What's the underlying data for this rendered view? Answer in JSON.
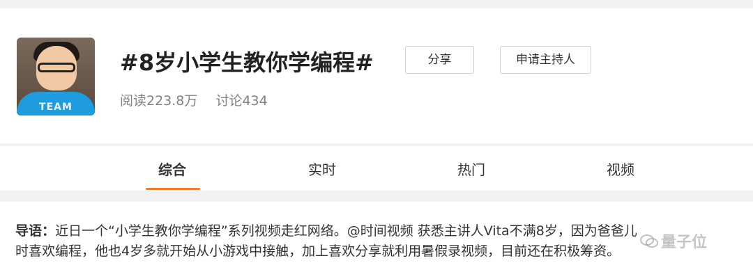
{
  "topic": {
    "title": "#8岁小学生教你学编程#",
    "share_label": "分享",
    "host_label": "申请主持人",
    "reads": "阅读223.8万",
    "discussions": "讨论434"
  },
  "avatar": {
    "shirt_text": "TEAM"
  },
  "tabs": [
    {
      "label": "综合",
      "active": true
    },
    {
      "label": "实时",
      "active": false
    },
    {
      "label": "热门",
      "active": false
    },
    {
      "label": "视频",
      "active": false
    }
  ],
  "intro": {
    "label": "导语：",
    "line1": "近日一个“小学生教你学编程”系列视频走红网络。@时间视频 获悉主讲人Vita不满8岁，因为爸爸儿",
    "line2": "时喜欢编程，他也4岁多就开始从小游戏中接触，加上喜欢分享就利用暑假录视频，目前还在积极筹资。"
  },
  "watermark": {
    "text": "量子位",
    "icon": "wechat-icon"
  },
  "colors": {
    "accent": "#f07d2b",
    "page_bg": "#f2f2f2",
    "muted_text": "#808080"
  }
}
